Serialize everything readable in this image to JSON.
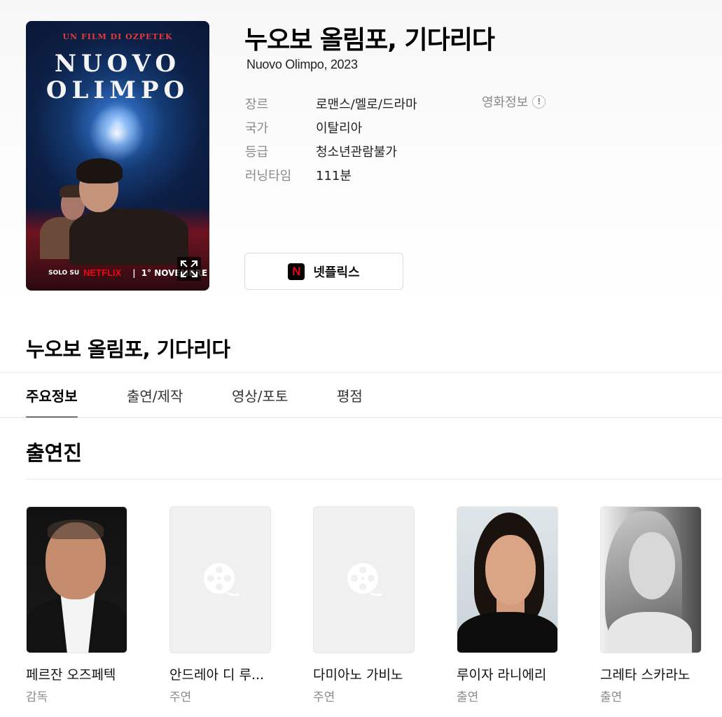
{
  "movie": {
    "title": "누오보 올림포, 기다리다",
    "original_title_year": "Nuovo Olimpo, 2023",
    "poster": {
      "tagline": "UN FILM DI OZPETEK",
      "title_line1": "NUOVO",
      "title_line2": "OLIMPO",
      "solo_su": "SOLO SU",
      "netflix": "NETFLIX",
      "separator": "|",
      "date": "1° NOVEMBRE"
    },
    "meta": [
      {
        "label": "장르",
        "value": "로맨스/멜로/드라마"
      },
      {
        "label": "국가",
        "value": "이탈리아"
      },
      {
        "label": "등급",
        "value": "청소년관람불가"
      },
      {
        "label": "러닝타임",
        "value": "111분"
      }
    ],
    "info_link": {
      "label": "영화정보",
      "badge": "!"
    },
    "streaming_button": {
      "logo": "N",
      "label": "넷플릭스"
    }
  },
  "section_title": "누오보 올림포, 기다리다",
  "tabs": [
    {
      "label": "주요정보",
      "active": true
    },
    {
      "label": "출연/제작",
      "active": false
    },
    {
      "label": "영상/포토",
      "active": false
    },
    {
      "label": "평점",
      "active": false
    }
  ],
  "cast_section": {
    "heading": "출연진",
    "members": [
      {
        "name": "페르잔 오즈페텍",
        "role": "감독",
        "photo": "director-photo"
      },
      {
        "name": "안드레아 디 루...",
        "role": "주연",
        "photo": "film-reel-icon"
      },
      {
        "name": "다미아노 가비노",
        "role": "주연",
        "photo": "film-reel-icon"
      },
      {
        "name": "루이자 라니에리",
        "role": "출연",
        "photo": "actress-photo"
      },
      {
        "name": "그레타 스카라노",
        "role": "출연",
        "photo": "actress-bw-photo"
      }
    ]
  },
  "colors": {
    "netflix_red": "#e50914",
    "active_tab": "#000000",
    "muted_text": "#8a8a8a",
    "placeholder_bg": "#f0f0f1"
  }
}
